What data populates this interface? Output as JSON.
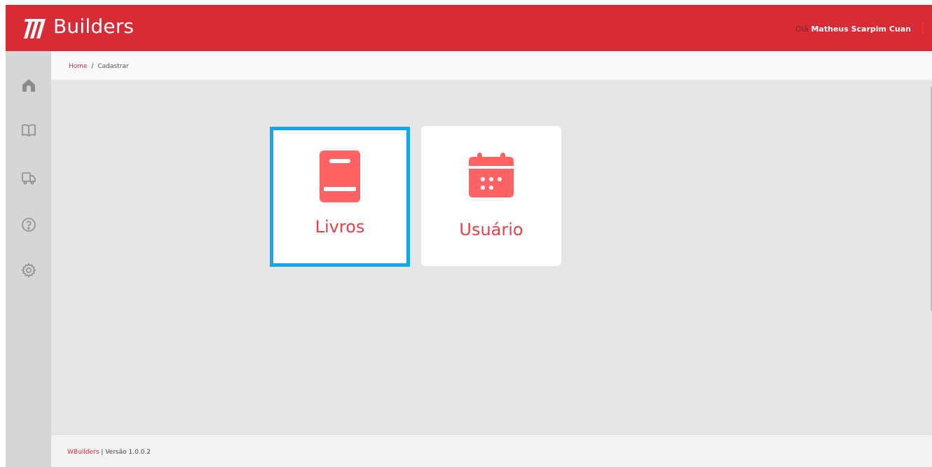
{
  "header": {
    "brand": "Builders",
    "greeting_prefix": "Olá",
    "user_name": "Matheus Scarpim Cuan"
  },
  "sidebar": {
    "items": [
      {
        "icon": "home-icon"
      },
      {
        "icon": "book-open-icon"
      },
      {
        "icon": "truck-icon"
      },
      {
        "icon": "help-icon"
      },
      {
        "icon": "gear-icon"
      }
    ]
  },
  "breadcrumb": {
    "home": "Home",
    "separator": "/",
    "current": "Cadastrar"
  },
  "cards": [
    {
      "label": "Livros",
      "icon": "book-icon",
      "selected": true
    },
    {
      "label": "Usuário",
      "icon": "calendar-icon",
      "selected": false
    }
  ],
  "footer": {
    "brand": "WBuilders",
    "separator": "|",
    "version_text": "Versão 1.0.0.2"
  },
  "colors": {
    "header_bg": "#d72b36",
    "accent": "#e8414a",
    "icon_red": "#ff6363",
    "selection": "#14a6e8"
  }
}
